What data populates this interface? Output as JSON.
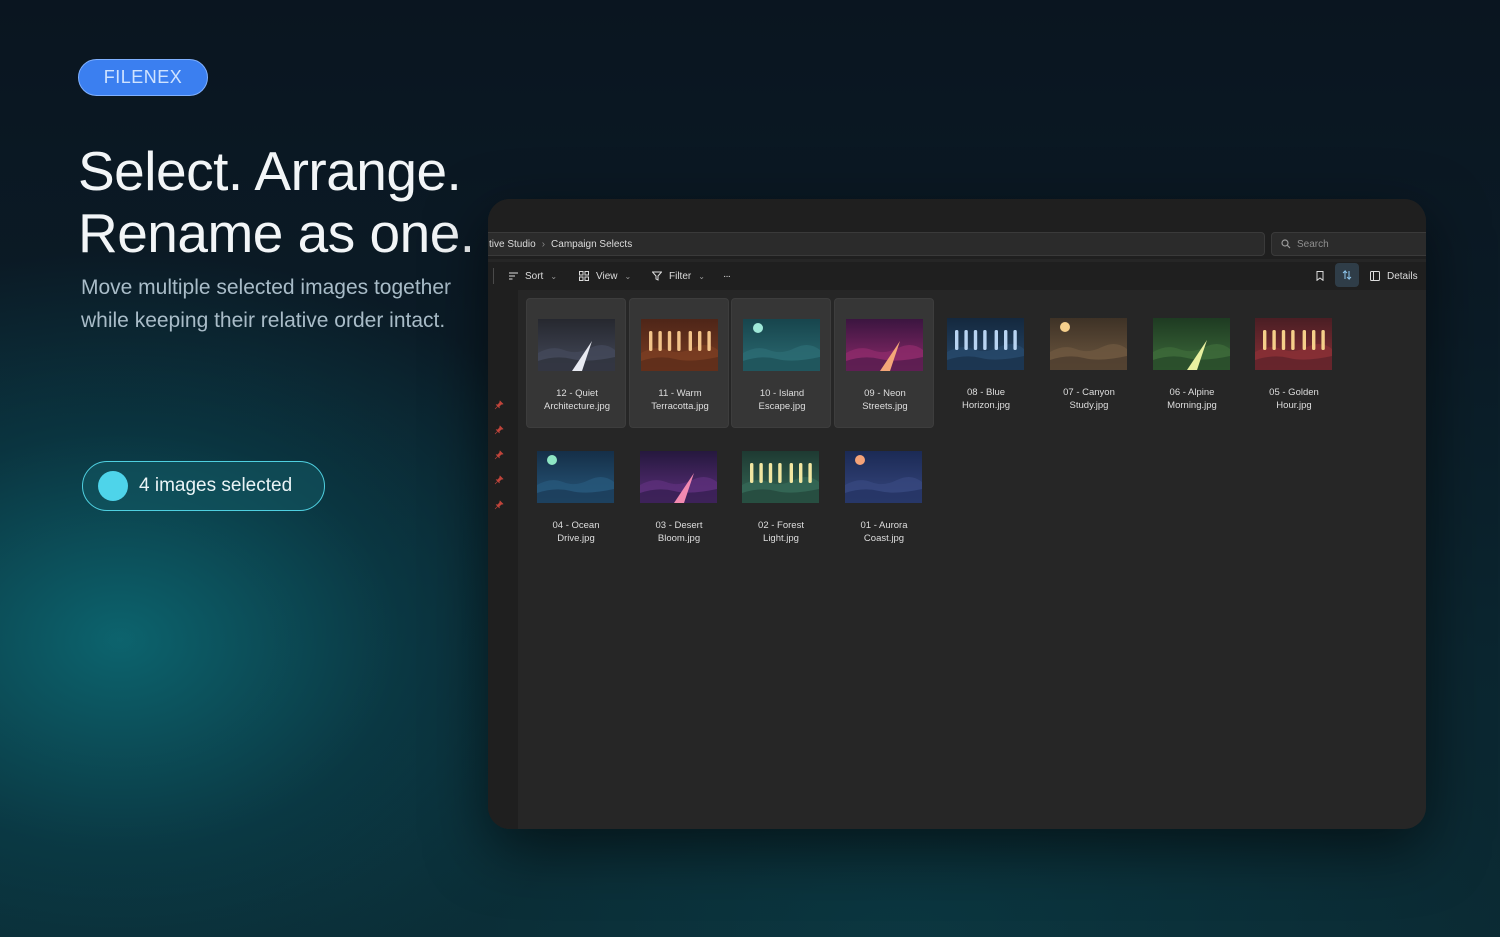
{
  "brand": {
    "label": "FILENEX"
  },
  "hero": {
    "line1": "Select. Arrange.",
    "line2": "Rename as one.",
    "subtext": "Move multiple selected images together while keeping their relative order intact."
  },
  "selection": {
    "label": "4 images selected"
  },
  "window": {
    "breadcrumb": [
      "tive Studio",
      "Campaign Selects"
    ],
    "search_placeholder": "Search",
    "toolbar": {
      "sort": "Sort",
      "view": "View",
      "filter": "Filter",
      "more": "···",
      "details": "Details"
    },
    "files": [
      {
        "line1": "12 - Quiet",
        "line2": "Architecture.jpg",
        "selected": true,
        "style": "road",
        "colors": [
          "#26282f",
          "#44495a",
          "#e8eaf2"
        ]
      },
      {
        "line1": "11 - Warm",
        "line2": "Terracotta.jpg",
        "selected": true,
        "style": "bars",
        "colors": [
          "#4e2518",
          "#7a3d22",
          "#f2c48a"
        ]
      },
      {
        "line1": "10 - Island",
        "line2": "Escape.jpg",
        "selected": true,
        "style": "sun",
        "colors": [
          "#17454d",
          "#2c6c73",
          "#9fe8d8"
        ]
      },
      {
        "line1": "09 - Neon",
        "line2": "Streets.jpg",
        "selected": true,
        "style": "road",
        "colors": [
          "#3b1540",
          "#8d2a6a",
          "#f4a678"
        ]
      },
      {
        "line1": "08 - Blue",
        "line2": "Horizon.jpg",
        "selected": false,
        "style": "bars",
        "colors": [
          "#14283e",
          "#27486a",
          "#b9d4f2"
        ]
      },
      {
        "line1": "07 - Canyon",
        "line2": "Study.jpg",
        "selected": false,
        "style": "sun",
        "colors": [
          "#3e3226",
          "#6e5840",
          "#f6d08c"
        ]
      },
      {
        "line1": "06 - Alpine",
        "line2": "Morning.jpg",
        "selected": false,
        "style": "road",
        "colors": [
          "#1e3b22",
          "#3d6a3a",
          "#e9f0a0"
        ]
      },
      {
        "line1": "05 - Golden",
        "line2": "Hour.jpg",
        "selected": false,
        "style": "bars",
        "colors": [
          "#4a1e24",
          "#8a3036",
          "#f6cf8a"
        ]
      },
      {
        "line1": "04 - Ocean",
        "line2": "Drive.jpg",
        "selected": false,
        "style": "sun",
        "colors": [
          "#152f48",
          "#27577a",
          "#8ee6c4"
        ]
      },
      {
        "line1": "03 - Desert",
        "line2": "Bloom.jpg",
        "selected": false,
        "style": "road",
        "colors": [
          "#25183e",
          "#5c2f7a",
          "#f28ab0"
        ]
      },
      {
        "line1": "02 - Forest",
        "line2": "Light.jpg",
        "selected": false,
        "style": "bars",
        "colors": [
          "#1e3a32",
          "#356856",
          "#f1e6a2"
        ]
      },
      {
        "line1": "01 - Aurora",
        "line2": "Coast.jpg",
        "selected": false,
        "style": "sun",
        "colors": [
          "#1b2a55",
          "#37477e",
          "#f4a278"
        ]
      }
    ]
  }
}
